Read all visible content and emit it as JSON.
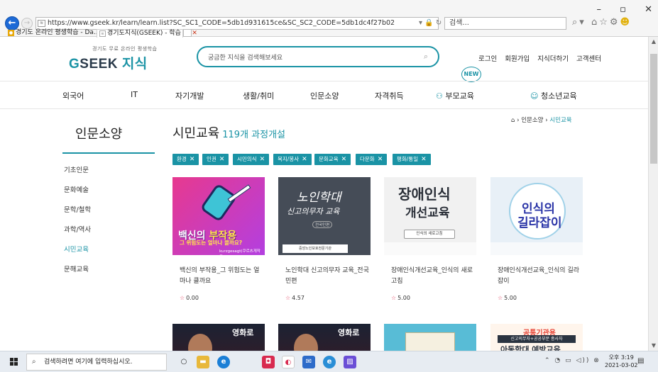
{
  "browser": {
    "address": "https://www.gseek.kr/learn/learn.list?SC_SC1_CODE=5db1d931615ce&SC_SC2_CODE=5db1dc4f27b02",
    "search_placeholder": "검색...",
    "tabs": [
      {
        "label": "경기도 온라인 평생학습 - Da..."
      },
      {
        "label": "경기도지식(GSEEK) - 학습 ..."
      }
    ]
  },
  "site": {
    "logo_sub": "경기도 무료 온라인 평생학습",
    "logo_main": "SEEK ",
    "logo_g": "G",
    "logo_ko": "지식",
    "search_placeholder": "궁금한 지식을 검색해보세요",
    "top_links": [
      "로그인",
      "회원가입",
      "지식더하기",
      "고객센터"
    ],
    "gnb": [
      "외국어",
      "IT",
      "자기개발",
      "생활/취미",
      "인문소양",
      "자격취득",
      "부모교육",
      "청소년교육"
    ],
    "new_badge": "NEW"
  },
  "breadcrumb": {
    "home": "⌂",
    "sep": "›",
    "level1": "인문소양",
    "current": "시민교육"
  },
  "sidebar": {
    "title": "인문소양",
    "items": [
      "기초인문",
      "문화예술",
      "문학/철학",
      "과학/역사",
      "시민교육",
      "문해교육"
    ],
    "active_index": 4
  },
  "main": {
    "title": "시민교육",
    "count": "119개 과정개설",
    "filters": [
      "환경",
      "인권",
      "시민의식",
      "복지/봉사",
      "문화교육",
      "다문화",
      "평화/통일"
    ],
    "courses": [
      {
        "title": "백신의 부작용_그 위험도는 얼마나 클까요",
        "rating": "0.00",
        "thumb_text_a": "백신의 ",
        "thumb_text_b": "부작용",
        "thumb_text_c": "그 위험도는 얼마나 클까요?",
        "thumb_text_d": "kurzgesagt(쿠르츠게작트)"
      },
      {
        "title": "노인학대 신고의무자 교육_전국민편",
        "rating": "4.57",
        "thumb_text_a": "노인학대",
        "thumb_text_b": "신고의무자 교육",
        "thumb_text_c": "전국민편",
        "thumb_text_d": "중앙노인보호전문기관"
      },
      {
        "title": "장애인식개선교육_인식의 새로고침",
        "rating": "5.00",
        "thumb_text_a": "장애인식",
        "thumb_text_b": "개선교육",
        "thumb_text_c": "인식의 새로고침"
      },
      {
        "title": "장애인식개선교육_인식의 길라잡이",
        "rating": "5.00",
        "thumb_text_a": "인식의",
        "thumb_text_b": "길라잡이"
      }
    ],
    "row2": {
      "r1_label": "영화로",
      "r2_label": "영화로",
      "r4_a": "공통기관용",
      "r4_b": "신고의무자+공공부문 종사자",
      "r4_c": "아동학대 예방교육"
    }
  },
  "taskbar": {
    "search_placeholder": "검색하려면 여기에 입력하십시오.",
    "time": "오후 3:19",
    "date": "2021-03-02"
  }
}
